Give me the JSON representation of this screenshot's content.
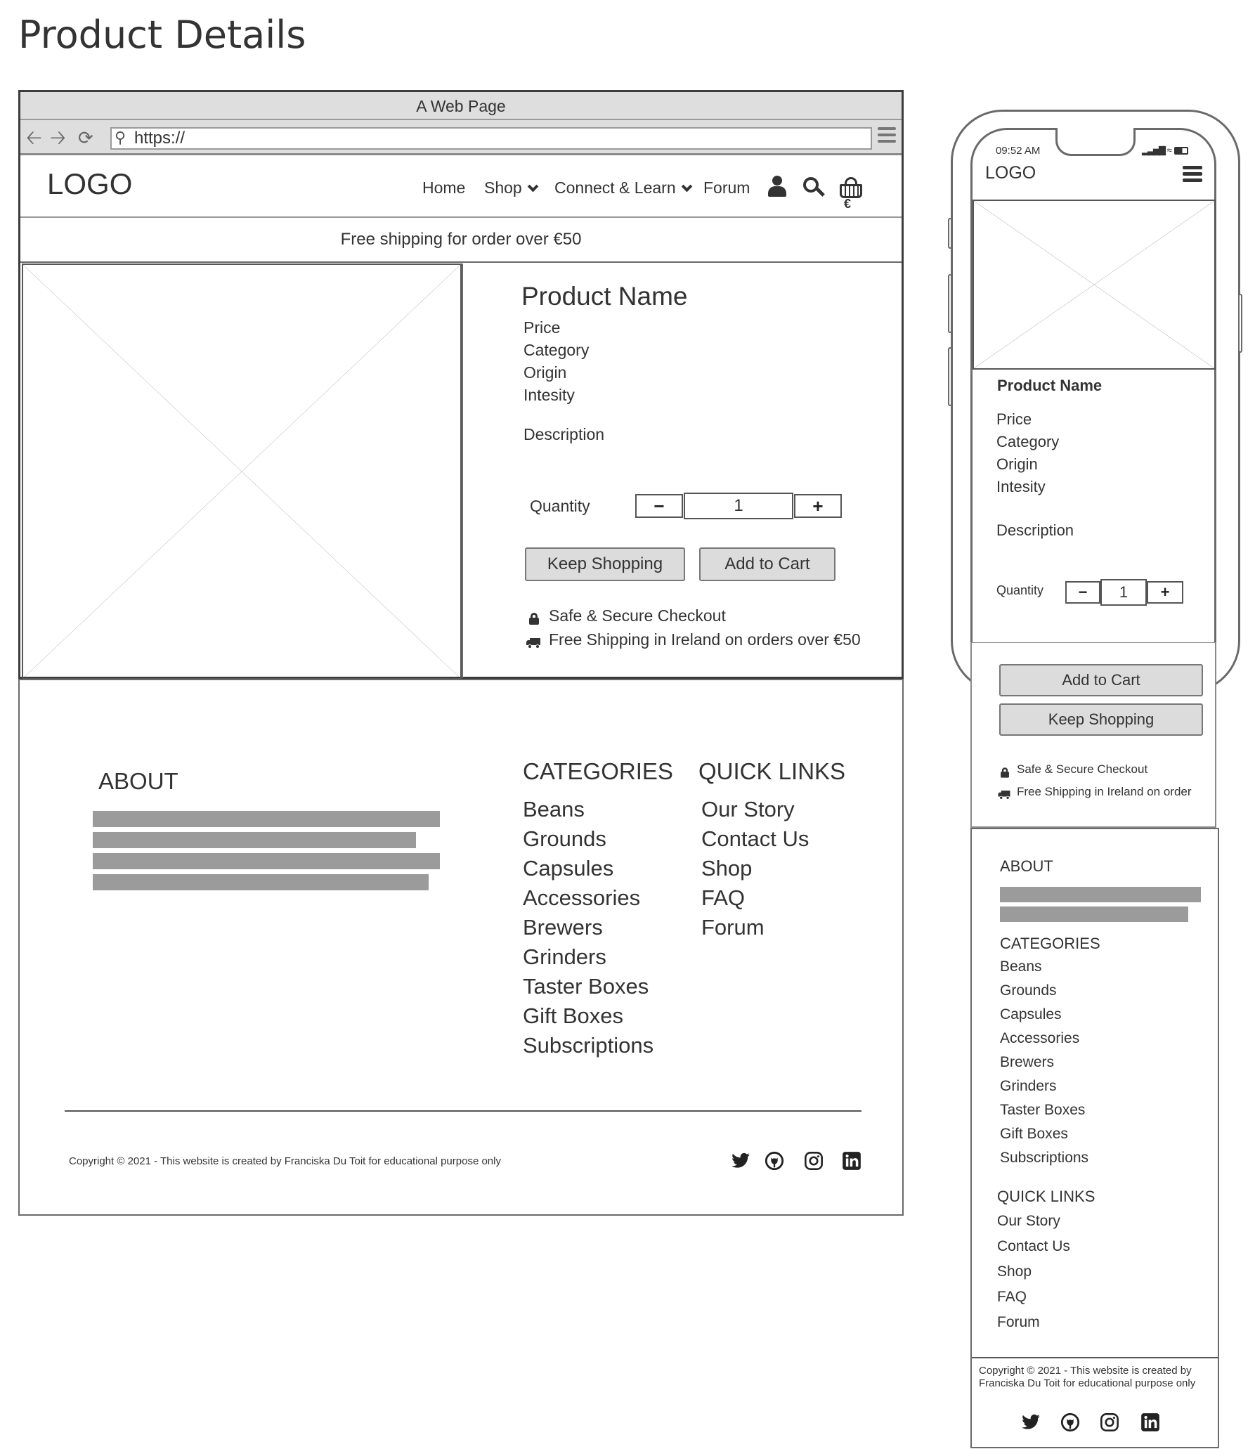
{
  "page_title": "Product Details",
  "browser": {
    "window_title": "A Web Page",
    "url": "https://",
    "icons": [
      "back-arrow-icon",
      "forward-arrow-icon",
      "refresh-icon",
      "search-icon",
      "hamburger-menu-icon"
    ]
  },
  "desktop": {
    "logo": "LOGO",
    "nav": [
      {
        "label": "Home",
        "dropdown": false
      },
      {
        "label": "Shop",
        "dropdown": true
      },
      {
        "label": "Connect & Learn",
        "dropdown": true
      },
      {
        "label": "Forum",
        "dropdown": false
      }
    ],
    "header_icons": [
      "user-icon",
      "search-icon",
      "basket-icon"
    ],
    "cart_total": "€",
    "banner": "Free shipping for order over €50",
    "product": {
      "name": "Product Name",
      "attributes": [
        "Price",
        "Category",
        "Origin",
        "Intesity"
      ],
      "description_label": "Description",
      "quantity_label": "Quantity",
      "quantity_value": "1",
      "decrement": "−",
      "increment": "+",
      "keep_shopping": "Keep Shopping",
      "add_to_cart": "Add to Cart",
      "secure_checkout": "Safe & Secure Checkout",
      "free_shipping": "Free Shipping in Ireland on orders over €50"
    },
    "footer": {
      "about_heading": "ABOUT",
      "categories_heading": "CATEGORIES",
      "categories": [
        "Beans",
        "Grounds",
        "Capsules",
        "Accessories",
        "Brewers",
        "Grinders",
        "Taster Boxes",
        "Gift Boxes",
        "Subscriptions"
      ],
      "quick_links_heading": "QUICK LINKS",
      "quick_links": [
        "Our Story",
        "Contact Us",
        "Shop",
        "FAQ",
        "Forum"
      ],
      "copyright": "Copyright © 2021 - This website is created by Franciska Du Toit for educational purpose only",
      "social_icons": [
        "twitter-icon",
        "github-icon",
        "instagram-icon",
        "linkedin-icon"
      ]
    }
  },
  "mobile": {
    "time": "09:52 AM",
    "logo": "LOGO",
    "product": {
      "name": "Product Name",
      "attributes": [
        "Price",
        "Category",
        "Origin",
        "Intesity"
      ],
      "description_label": "Description",
      "quantity_label": "Quantity",
      "quantity_value": "1",
      "decrement": "−",
      "increment": "+",
      "add_to_cart": "Add to Cart",
      "keep_shopping": "Keep Shopping",
      "secure_checkout": "Safe & Secure Checkout",
      "free_shipping": "Free Shipping in Ireland on  order"
    },
    "footer": {
      "about_heading": "ABOUT",
      "categories_heading": "CATEGORIES",
      "categories": [
        "Beans",
        "Grounds",
        "Capsules",
        "Accessories",
        "Brewers",
        "Grinders",
        "Taster Boxes",
        "Gift Boxes",
        "Subscriptions"
      ],
      "quick_links_heading": "QUICK LINKS",
      "quick_links": [
        "Our Story",
        "Contact Us",
        "Shop",
        "FAQ",
        "Forum"
      ],
      "copyright": "Copyright © 2021 - This website is created by Franciska Du Toit for educational purpose only",
      "social_icons": [
        "twitter-icon",
        "github-icon",
        "instagram-icon",
        "linkedin-icon"
      ]
    }
  },
  "colors": {
    "chrome_grey": "#dedede",
    "placeholder_bar": "#9b9b9b",
    "button_grey": "#dcdcdc",
    "text": "#333333"
  }
}
